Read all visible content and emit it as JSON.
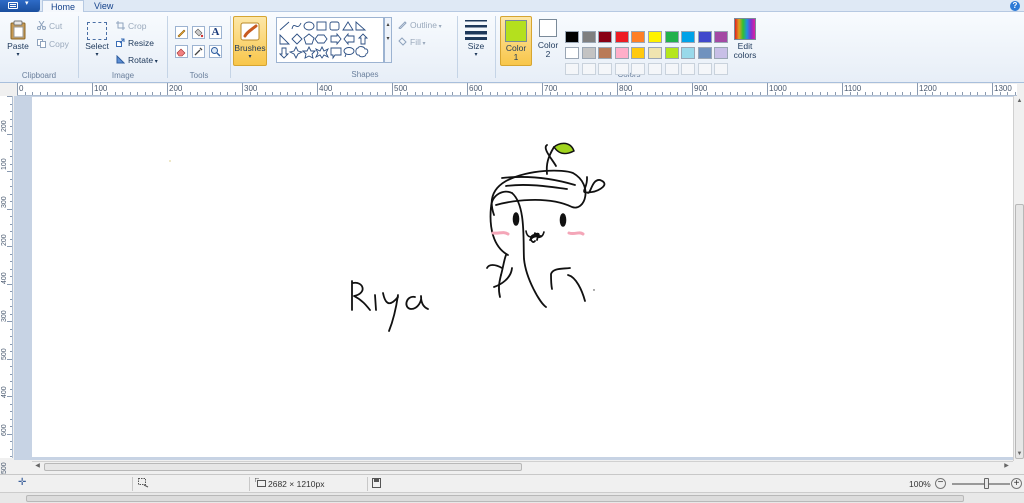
{
  "tabs": [
    {
      "label": "Home"
    },
    {
      "label": "View"
    }
  ],
  "help_symbol": "?",
  "clipboard": {
    "paste": "Paste",
    "cut": "Cut",
    "copy": "Copy",
    "group": "Clipboard"
  },
  "image": {
    "select": "Select",
    "crop": "Crop",
    "resize": "Resize",
    "rotate": "Rotate",
    "group": "Image"
  },
  "tools": {
    "group": "Tools",
    "text_glyph": "A"
  },
  "brushes": {
    "label": "Brushes"
  },
  "shapes": {
    "group": "Shapes",
    "outline": "Outline",
    "fill": "Fill"
  },
  "size": {
    "label": "Size"
  },
  "colors": {
    "color1": "Color",
    "color1_num": "1",
    "color2": "Color",
    "color2_num": "2",
    "edit": "Edit",
    "edit2": "colors",
    "group": "Colors",
    "current1": "#b4e01e",
    "current2": "#ffffff",
    "palette_row1": [
      "#000000",
      "#7f7f7f",
      "#880015",
      "#ed1c24",
      "#ff7f27",
      "#fff200",
      "#22b14c",
      "#00a2e8",
      "#3f48cc",
      "#a349a4"
    ],
    "palette_row2": [
      "#ffffff",
      "#c3c3c3",
      "#b97a57",
      "#ffaec9",
      "#ffc90e",
      "#efe4b0",
      "#b5e61d",
      "#99d9ea",
      "#7092be",
      "#c8bfe7"
    ]
  },
  "ruler": {
    "h": [
      "0",
      "100",
      "200",
      "300",
      "400",
      "500",
      "600",
      "700",
      "800",
      "900",
      "1000",
      "1100",
      "1200",
      "1300"
    ],
    "v": [
      "200",
      "100",
      "300",
      "200",
      "400",
      "300",
      "500",
      "400",
      "600",
      "500"
    ]
  },
  "drawing": {
    "name": "Riya"
  },
  "status": {
    "dimensions": "2682 × 1210px",
    "zoom": "100%"
  }
}
